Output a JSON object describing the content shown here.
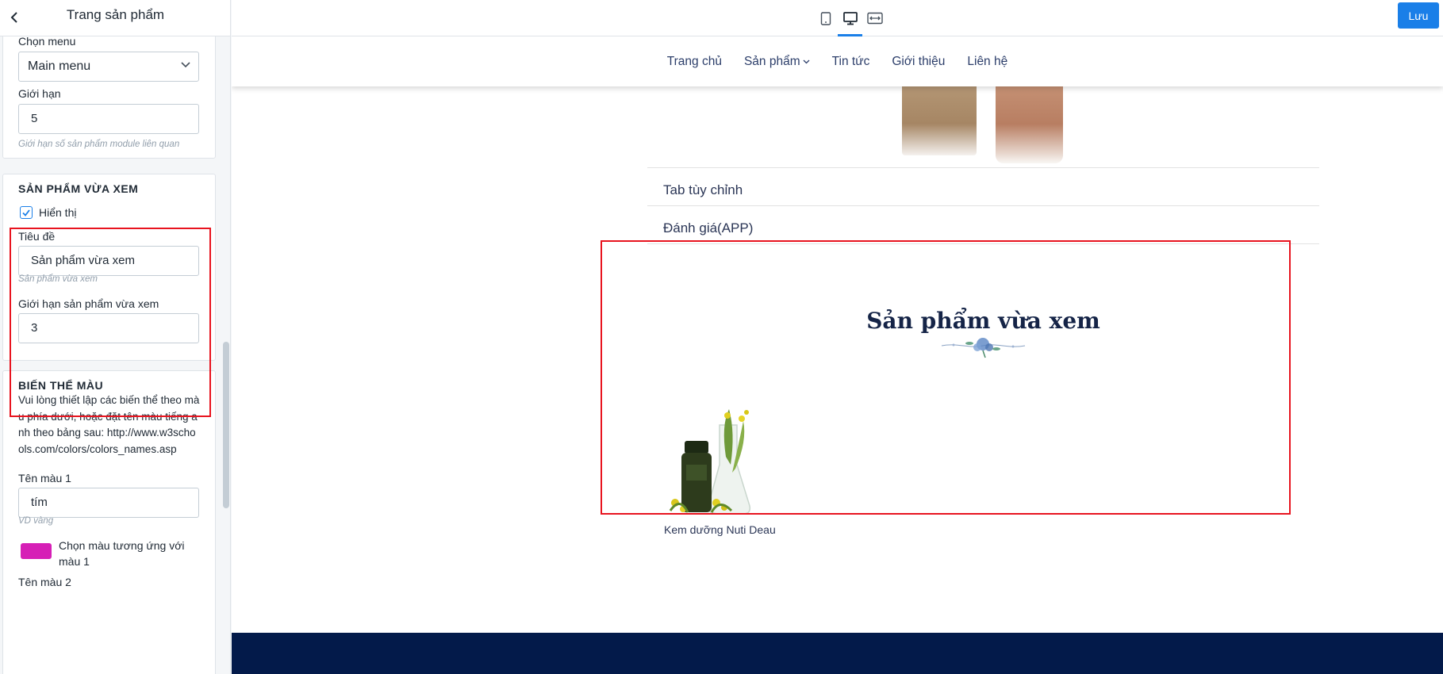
{
  "sidebar": {
    "title": "Trang sản phẩm",
    "menu": {
      "label": "Chọn menu",
      "selected": "Main menu"
    },
    "limit": {
      "label": "Giới hạn",
      "value": "5",
      "help": "Giới hạn số sản phẩm module liên quan"
    },
    "recent": {
      "section_title": "SẢN PHẨM VỪA XEM",
      "show_label": "Hiển thị",
      "show_checked": true,
      "title_label": "Tiêu đề",
      "title_value": "Sản phẩm vừa xem",
      "title_help": "Sản phẩm vừa xem",
      "limit_label": "Giới hạn sản phẩm vừa xem",
      "limit_value": "3"
    },
    "color_variants": {
      "section_title": "BIẾN THỂ MÀU",
      "description": "Vui lòng thiết lập các biến thể theo màu phía dưới, hoặc đặt tên màu tiếng anh theo bảng sau: http://www.w3schools.com/colors/colors_names.asp",
      "color1_label": "Tên màu 1",
      "color1_value": "tím",
      "color1_help": "VD vàng",
      "color1_pick_label": "Chọn màu tương ứng với màu 1",
      "color1_swatch": "#d61fb6",
      "color2_label": "Tên màu 2"
    }
  },
  "topbar": {
    "devices": [
      "mobile-icon",
      "desktop-icon",
      "fullwidth-icon"
    ],
    "active_device": "desktop-icon",
    "save_label": "Lưu",
    "accent": "#1a7fe8"
  },
  "preview": {
    "nav": [
      "Trang chủ",
      "Sản phẩm",
      "Tin tức",
      "Giới thiệu",
      "Liên hệ"
    ],
    "tabs": [
      "Tab tùy chỉnh",
      "Đánh giá(APP)"
    ],
    "recent_title": "Sản phẩm vừa xem",
    "recent_products": [
      {
        "name": "Kem dưỡng Nuti Deau"
      }
    ],
    "footer_color": "#031a4a",
    "highlight_color": "#e8141f"
  }
}
